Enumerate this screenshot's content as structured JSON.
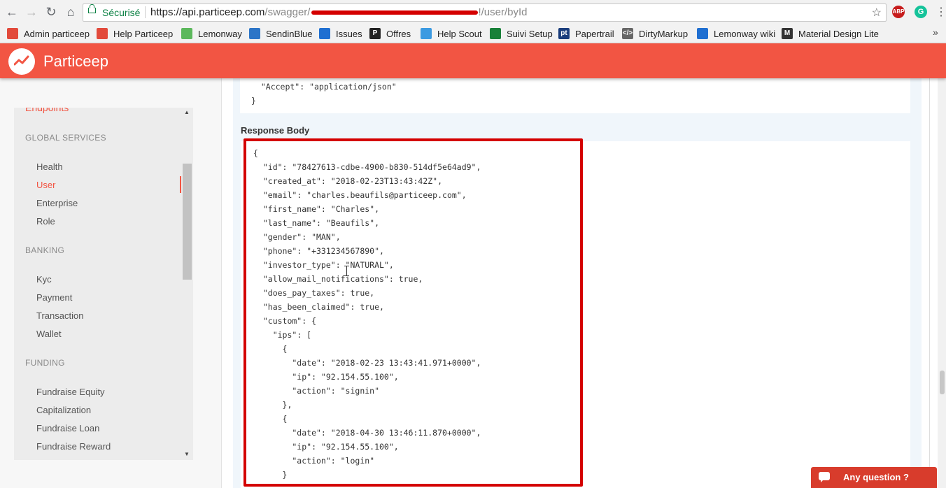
{
  "browser": {
    "secure_label": "Sécurisé",
    "url_host": "https://api.particeep.com",
    "url_path_start": "/swagger/",
    "url_path_end": "!/user/byId",
    "extensions": {
      "abp": "ABP",
      "grammarly": "G"
    }
  },
  "bookmarks": [
    {
      "label": "Admin particeep",
      "icon": "particeep-icon",
      "color": "#e24a3b"
    },
    {
      "label": "Help Particeep",
      "icon": "particeep-icon",
      "color": "#e24a3b"
    },
    {
      "label": "Lemonway",
      "icon": "lemonway-icon",
      "color": "#5cb85c"
    },
    {
      "label": "SendinBlue",
      "icon": "sendinblue-icon",
      "color": "#2c75c7"
    },
    {
      "label": "Issues",
      "icon": "shield-icon",
      "color": "#1f6fd1"
    },
    {
      "label": "Offres",
      "icon": "p-icon",
      "color": "#222222",
      "glyph": "P"
    },
    {
      "label": "Help Scout",
      "icon": "helpscout-icon",
      "color": "#3b9ae1"
    },
    {
      "label": "Suivi Setup",
      "icon": "sheets-icon",
      "color": "#188038"
    },
    {
      "label": "Papertrail",
      "icon": "pt-icon",
      "color": "#1a3d7c",
      "glyph": "pt"
    },
    {
      "label": "DirtyMarkup",
      "icon": "code-icon",
      "color": "#666666",
      "glyph": "</>"
    },
    {
      "label": "Lemonway wiki",
      "icon": "shield-icon",
      "color": "#1f6fd1"
    },
    {
      "label": "Material Design Lite",
      "icon": "m-icon",
      "color": "#333333",
      "glyph": "M"
    }
  ],
  "header": {
    "brand": "Particeep",
    "accent": "#f25543"
  },
  "sidebar": {
    "top_link": "Endpoints",
    "sections": [
      {
        "title": "GLOBAL SERVICES",
        "items": [
          "Health",
          "User",
          "Enterprise",
          "Role"
        ]
      },
      {
        "title": "BANKING",
        "items": [
          "Kyc",
          "Payment",
          "Transaction",
          "Wallet"
        ]
      },
      {
        "title": "FUNDING",
        "items": [
          "Fundraise Equity",
          "Capitalization",
          "Fundraise Loan",
          "Fundraise Reward"
        ]
      }
    ],
    "active_item": "User"
  },
  "request_headers": {
    "accept_line": "  \"Accept\": \"application/json\"",
    "close": "}"
  },
  "response": {
    "title": "Response Body",
    "lines": [
      "{",
      "  \"id\": \"78427613-cdbe-4900-b830-514df5e64ad9\",",
      "  \"created_at\": \"2018-02-23T13:43:42Z\",",
      "  \"email\": \"charles.beaufils@particeep.com\",",
      "  \"first_name\": \"Charles\",",
      "  \"last_name\": \"Beaufils\",",
      "  \"gender\": \"MAN\",",
      "  \"phone\": \"+331234567890\",",
      "  \"investor_type\": \"NATURAL\",",
      "  \"allow_mail_notifications\": true,",
      "  \"does_pay_taxes\": true,",
      "  \"has_been_claimed\": true,",
      "  \"custom\": {",
      "    \"ips\": [",
      "      {",
      "        \"date\": \"2018-02-23 13:43:41.971+0000\",",
      "        \"ip\": \"92.154.55.100\",",
      "        \"action\": \"signin\"",
      "      },",
      "      {",
      "        \"date\": \"2018-04-30 13:46:11.870+0000\",",
      "        \"ip\": \"92.154.55.100\",",
      "        \"action\": \"login\"",
      "      }"
    ]
  },
  "chat": {
    "label": "Any question ?"
  }
}
